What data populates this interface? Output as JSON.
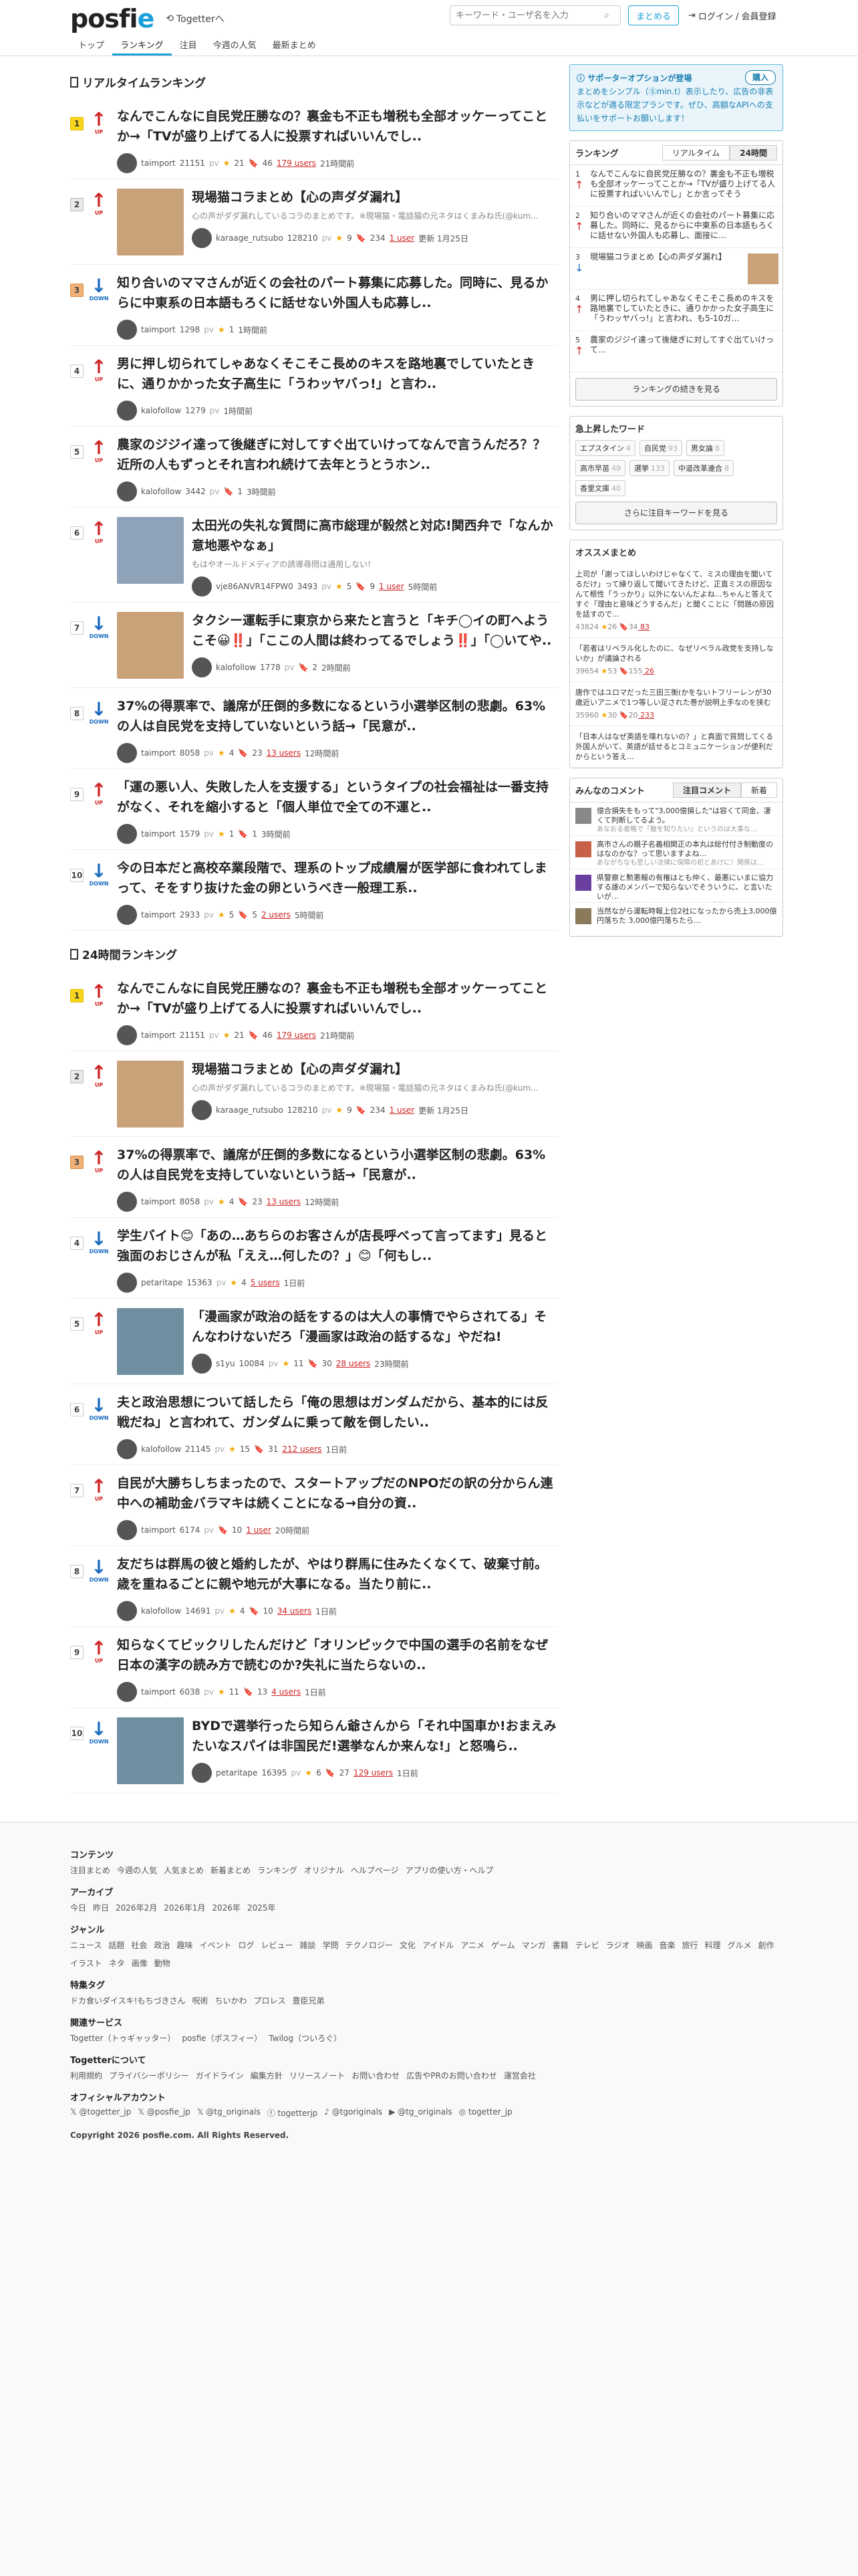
{
  "header": {
    "logo": "posfie",
    "togetter_link": "Togetterへ",
    "search_placeholder": "キーワード・ユーザ名を入力",
    "matome_button": "まとめる",
    "login": "ログイン / 会員登録"
  },
  "nav": [
    "トップ",
    "ランキング",
    "注目",
    "今週の人気",
    "最新まとめ"
  ],
  "realtime_title": "リアルタイムランキング",
  "realtime": [
    {
      "rank": "1",
      "move": "UP",
      "title": "なんでこんなに自民党圧勝なの？裏金も不正も増税も全部オッケーってことか→「TVが盛り上げてる人に投票すればいいんでし..",
      "desc": "",
      "user": "taimport",
      "pv": "21151",
      "stars": "21",
      "bm": "46",
      "users": "179 users",
      "time": "21時間前",
      "img": false
    },
    {
      "rank": "2",
      "move": "UP",
      "title": "現場猫コラまとめ【心の声ダダ漏れ】",
      "desc": "心の声がダダ漏れしているコラのまとめです。※現場猫・電話猫の元ネタはくまみね氏(@kum...",
      "user": "karaage_rutsubo",
      "pv": "128210",
      "stars": "9",
      "bm": "234",
      "users": "1 user",
      "time": "更新 1月25日",
      "img": true
    },
    {
      "rank": "3",
      "move": "DOWN",
      "title": "知り合いのママさんが近くの会社のパート募集に応募した。同時に、見るからに中東系の日本語もろくに話せない外国人も応募し..",
      "desc": "",
      "user": "taimport",
      "pv": "1298",
      "stars": "1",
      "bm": "",
      "users": "",
      "time": "1時間前",
      "img": false
    },
    {
      "rank": "4",
      "move": "UP",
      "title": "男に押し切られてしゃあなくそこそこ長めのキスを路地裏でしていたときに、通りかかった女子高生に「うわッヤバっ!」と言わ..",
      "desc": "",
      "user": "kalofollow",
      "pv": "1279",
      "stars": "",
      "bm": "",
      "users": "",
      "time": "1時間前",
      "img": false
    },
    {
      "rank": "5",
      "move": "UP",
      "title": "農家のジジイ達って後継ぎに対してすぐ出ていけってなんで言うんだろ？？近所の人もずっとそれ言われ続けて去年とうとうホン..",
      "desc": "",
      "user": "kalofollow",
      "pv": "3442",
      "stars": "",
      "bm": "1",
      "users": "",
      "time": "3時間前",
      "img": false
    },
    {
      "rank": "6",
      "move": "UP",
      "title": "太田光の失礼な質問に高市総理が毅然と対応!関西弁で「なんか意地悪やなぁ」",
      "desc": "もはやオールドメディアの誘導尋問は通用しない!",
      "user": "vje86ANVR14FPW0",
      "pv": "3493",
      "stars": "5",
      "bm": "9",
      "users": "1 user",
      "time": "5時間前",
      "img": true
    },
    {
      "rank": "7",
      "move": "DOWN",
      "title": "タクシー運転手に東京から来たと言うと「キチ◯イの町へようこそ😀‼️」「ここの人間は終わってるでしょう‼️」「◯いてや..",
      "desc": "",
      "user": "kalofollow",
      "pv": "1778",
      "stars": "",
      "bm": "2",
      "users": "",
      "time": "2時間前",
      "img": true
    },
    {
      "rank": "8",
      "move": "DOWN",
      "title": "37%の得票率で、議席が圧倒的多数になるという小選挙区制の悲劇。63%の人は自民党を支持していないという話→「民意が..",
      "desc": "",
      "user": "taimport",
      "pv": "8058",
      "stars": "4",
      "bm": "23",
      "users": "13 users",
      "time": "12時間前",
      "img": false
    },
    {
      "rank": "9",
      "move": "UP",
      "title": "「運の悪い人、失敗した人を支援する」というタイプの社会福祉は一番支持がなく、それを縮小すると「個人単位で全ての不運と..",
      "desc": "",
      "user": "taimport",
      "pv": "1579",
      "stars": "1",
      "bm": "1",
      "users": "",
      "time": "3時間前",
      "img": false
    },
    {
      "rank": "10",
      "move": "DOWN",
      "title": "今の日本だと高校卒業段階で、理系のトップ成績層が医学部に食われてしまって、そをすり抜けた金の卵というべき一般理工系..",
      "desc": "",
      "user": "taimport",
      "pv": "2933",
      "stars": "5",
      "bm": "5",
      "users": "2 users",
      "time": "5時間前",
      "img": false
    }
  ],
  "daily_title": "24時間ランキング",
  "daily": [
    {
      "rank": "1",
      "move": "UP",
      "title": "なんでこんなに自民党圧勝なの？裏金も不正も増税も全部オッケーってことか→「TVが盛り上げてる人に投票すればいいんでし..",
      "desc": "",
      "user": "taimport",
      "pv": "21151",
      "stars": "21",
      "bm": "46",
      "users": "179 users",
      "time": "21時間前",
      "img": false
    },
    {
      "rank": "2",
      "move": "UP",
      "title": "現場猫コラまとめ【心の声ダダ漏れ】",
      "desc": "心の声がダダ漏れしているコラのまとめです。※現場猫・電話猫の元ネタはくまみね氏(@kum...",
      "user": "karaage_rutsubo",
      "pv": "128210",
      "stars": "9",
      "bm": "234",
      "users": "1 user",
      "time": "更新 1月25日",
      "img": true
    },
    {
      "rank": "3",
      "move": "UP",
      "title": "37%の得票率で、議席が圧倒的多数になるという小選挙区制の悲劇。63%の人は自民党を支持していないという話→「民意が..",
      "desc": "",
      "user": "taimport",
      "pv": "8058",
      "stars": "4",
      "bm": "23",
      "users": "13 users",
      "time": "12時間前",
      "img": false
    },
    {
      "rank": "4",
      "move": "DOWN",
      "title": "学生バイト😊「あの…あちらのお客さんが店長呼べって言ってます」見ると強面のおじさんが私「ええ…何したの？」😊「何もし..",
      "desc": "",
      "user": "petaritape",
      "pv": "15363",
      "stars": "4",
      "bm": "",
      "users": "5 users",
      "time": "1日前",
      "img": false
    },
    {
      "rank": "5",
      "move": "UP",
      "title": "「漫画家が政治の話をするのは大人の事情でやらされてる」そんなわけないだろ「漫画家は政治の話するな」やだね!",
      "desc": "",
      "user": "s1yu",
      "pv": "10084",
      "stars": "11",
      "bm": "30",
      "users": "28 users",
      "time": "23時間前",
      "img": true
    },
    {
      "rank": "6",
      "move": "DOWN",
      "title": "夫と政治思想について話したら「俺の思想はガンダムだから、基本的には反戦だね」と言われて、ガンダムに乗って敵を倒したい..",
      "desc": "",
      "user": "kalofollow",
      "pv": "21145",
      "stars": "15",
      "bm": "31",
      "users": "212 users",
      "time": "1日前",
      "img": false
    },
    {
      "rank": "7",
      "move": "UP",
      "title": "自民が大勝ちしちまったので、スタートアップだのNPOだの訳の分からん連中への補助金バラマキは続くことになる→自分の資..",
      "desc": "",
      "user": "taimport",
      "pv": "6174",
      "stars": "",
      "bm": "10",
      "users": "1 user",
      "time": "20時間前",
      "img": false
    },
    {
      "rank": "8",
      "move": "DOWN",
      "title": "友だちは群馬の彼と婚約したが、やはり群馬に住みたくなくて、破棄寸前。歳を重ねるごとに親や地元が大事になる。当たり前に..",
      "desc": "",
      "user": "kalofollow",
      "pv": "14691",
      "stars": "4",
      "bm": "10",
      "users": "34 users",
      "time": "1日前",
      "img": false
    },
    {
      "rank": "9",
      "move": "UP",
      "title": "知らなくてビックリしたんだけど「オリンピックで中国の選手の名前をなぜ日本の漢字の読み方で読むのか?失礼に当たらないの..",
      "desc": "",
      "user": "taimport",
      "pv": "6038",
      "stars": "11",
      "bm": "13",
      "users": "4 users",
      "time": "1日前",
      "img": false
    },
    {
      "rank": "10",
      "move": "DOWN",
      "title": "BYDで選挙行ったら知らん爺さんから「それ中国車か!おまえみたいなスパイは非国民だ!選挙なんか来んな!」と怒鳴ら..",
      "desc": "",
      "user": "petaritape",
      "pv": "16395",
      "stars": "6",
      "bm": "27",
      "users": "129 users",
      "time": "1日前",
      "img": true
    }
  ],
  "side": {
    "support_head": "サポーターオプションが登場",
    "support_buy": "購入",
    "support_text": "まとめをシンプル（Ⓢmin.t）表示したり、広告の非表示などが適る限定プランです。ぜひ、高額なAPIへの支払いをサポートお願いします！",
    "ranking_head": "ランキング",
    "tab_rt": "リアルタイム",
    "tab_24": "24時間",
    "ranking": [
      {
        "n": "1",
        "mv": "UP",
        "t": "なんでこんなに自民党圧勝なの？裏金も不正も増税も全部オッケーってことか→「TVが盛り上げてる人に投票すればいいんでし」とか言ってそう",
        "img": false
      },
      {
        "n": "2",
        "mv": "UP",
        "t": "知り合いのママさんが近くの会社のパート募集に応募した。同時に、見るからに中東系の日本語もろくに話せない外国人も応募し、面接に…",
        "img": false
      },
      {
        "n": "3",
        "mv": "DOWN",
        "t": "現場猫コラまとめ【心の声ダダ漏れ】",
        "img": true
      },
      {
        "n": "4",
        "mv": "UP",
        "t": "男に押し切られてしゃあなくそこそこ長めのキスを路地裏でしていたときに、通りかかった女子高生に「うわッヤバっ!」と言われ、も5-10ガ…",
        "img": false
      },
      {
        "n": "5",
        "mv": "UP",
        "t": "農家のジジイ達って後継ぎに対してすぐ出ていけって…",
        "img": false
      }
    ],
    "ranking_more": "ランキングの続きを見る",
    "kw_head": "急上昇したワード",
    "keywords": [
      {
        "w": "エプスタイン",
        "c": "4"
      },
      {
        "w": "自民党",
        "c": "93"
      },
      {
        "w": "男女論",
        "c": "8"
      },
      {
        "w": "高市早苗",
        "c": "49"
      },
      {
        "w": "選挙",
        "c": "133"
      },
      {
        "w": "中道改革連合",
        "c": "8"
      },
      {
        "w": "香里文庫",
        "c": "40"
      }
    ],
    "kw_more": "さらに注目キーワードを見る",
    "osusume_head": "オススメまとめ",
    "osusume": [
      {
        "t": "上司が「謝ってほしいわけじゃなくて、ミスの理由を聞いてるだけ」って繰り返して聞いてきたけど、正直ミスの原因なんて根性「うっかり」以外にないんだよね…ちゃんと答えてすぐ「理由と意味どうするんだ」と聞くことに「問題の原因を話すので…",
        "m": "43824",
        "s": "26",
        "b": "34",
        "u": "83"
      },
      {
        "t": "「若者はリベラル化したのに、なぜリベラル政党を支持しないか」が議論される",
        "m": "39654",
        "s": "53",
        "b": "155",
        "u": "26"
      },
      {
        "t": "唐作ではユロマだった三田三衡(かをないトフリーレンが30歳近いアニメで1つ等しい足された巻が説明上手なのを挟む",
        "m": "35960",
        "s": "30",
        "b": "20",
        "u": "233"
      },
      {
        "t": "「日本人はなぜ英語を喋れないの？」と真面で質問してくる外国人がいて、英語が話せるとコミュニケーションが便利だからという答え…",
        "m": "",
        "s": "",
        "b": "",
        "u": ""
      }
    ],
    "comments_head": "みんなのコメント",
    "comments_tab1": "注目コメント",
    "comments_tab2": "新着",
    "comments": [
      {
        "t": "億合損失をもって\"3,000億損した\"は容くて同金、凄くて判断してるよう。",
        "s": "あなおる者略で『敵を知りたい』というのは大事な…",
        "l": "14"
      },
      {
        "t": "高市さんの親子名義相関正の本丸は総付付き制動度のはなのかな？って思いますよね…",
        "s": "あながちなも悲しい法律に保障の初とあけに！関係は…",
        "l": "5"
      },
      {
        "t": "県警察と勲悪報の有権はとも仲く、最悪にいまに協力する誰のメンバーで知らないでそういうに、と言いたいが…",
        "s": "太田がない対策にてそうだ…あなたい場所になって…",
        "l": "6"
      },
      {
        "t": "当然ながら運転時報上位2社になったから売上3,000億円落ちた 3,000億円落ちたら…",
        "s": "",
        "l": ""
      }
    ]
  },
  "footer": {
    "sections": [
      {
        "h": "コンテンツ",
        "links": [
          "注目まとめ",
          "今週の人気",
          "人気まとめ",
          "新着まとめ",
          "ランキング",
          "オリジナル",
          "ヘルプページ",
          "アプリの使い方・ヘルプ"
        ]
      },
      {
        "h": "アーカイブ",
        "links": [
          "今日",
          "昨日",
          "2026年2月",
          "2026年1月",
          "2026年",
          "2025年"
        ]
      },
      {
        "h": "ジャンル",
        "links": [
          "ニュース",
          "話題",
          "社会",
          "政治",
          "趣味",
          "イベント",
          "ログ",
          "レビュー",
          "雑談",
          "学問",
          "テクノロジー",
          "文化",
          "アイドル",
          "アニメ",
          "ゲーム",
          "マンガ",
          "書籍",
          "テレビ",
          "ラジオ",
          "映画",
          "音楽",
          "旅行",
          "料理",
          "グルメ",
          "創作",
          "イラスト",
          "ネタ",
          "画像",
          "動物"
        ]
      },
      {
        "h": "特集タグ",
        "links": [
          "ドカ食いダイスキ!もちづきさん",
          "呪術",
          "ちいかわ",
          "プロレス",
          "豊臣兄弟"
        ]
      },
      {
        "h": "関連サービス",
        "links": [
          "Togetter（トゥギャッター）",
          "posfie（ポスフィー）",
          "Twilog（ついろぐ）"
        ]
      },
      {
        "h": "Togetterについて",
        "links": [
          "利用規約",
          "プライバシーポリシー",
          "ガイドライン",
          "編集方針",
          "リリースノート",
          "お問い合わせ",
          "広告やPRのお問い合わせ",
          "運営会社"
        ]
      },
      {
        "h": "オフィシャルアカウント",
        "links": [
          "𝕏 @togetter_jp",
          "𝕏 @posfie_jp",
          "𝕏 @tg_originals",
          "ⓕ togetterjp",
          "♪ @tgoriginals",
          "▶ @tg_originals",
          "◎ togetter_jp"
        ]
      }
    ],
    "copyright": "Copyright 2026 posfie.com. All Rights Reserved."
  }
}
